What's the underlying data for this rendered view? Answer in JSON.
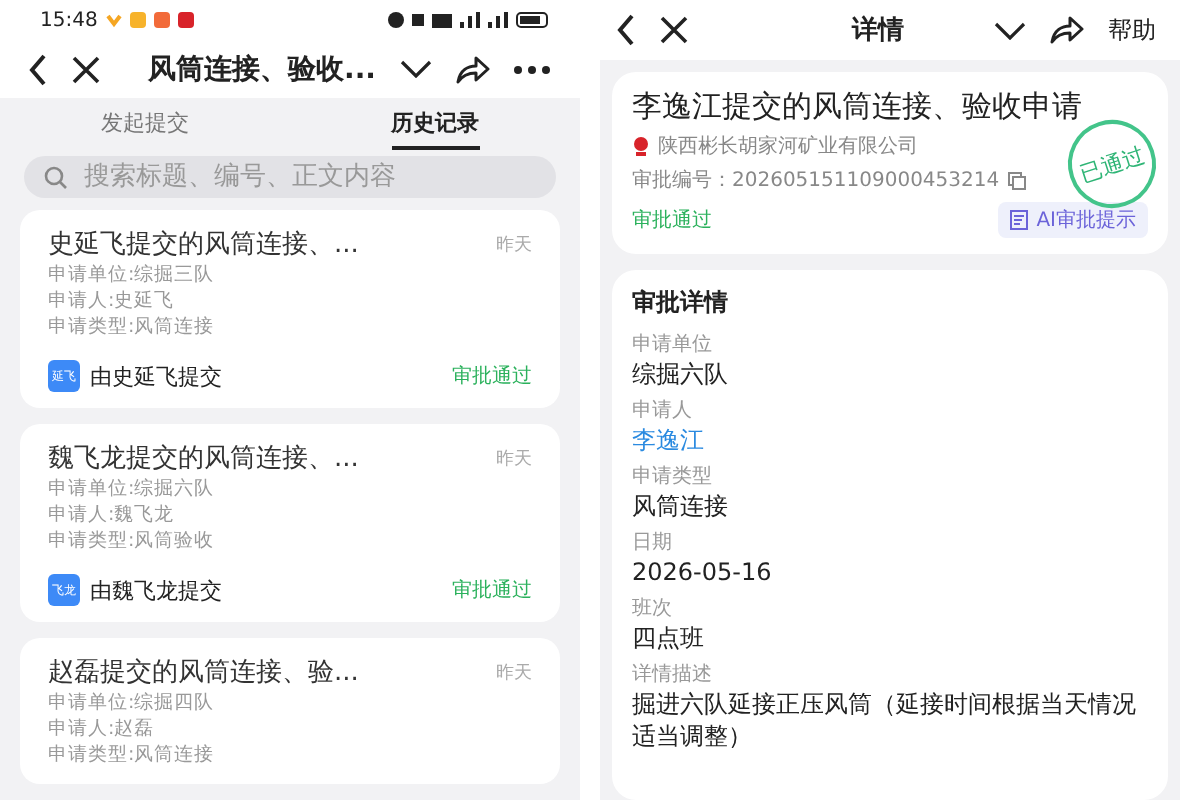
{
  "status_bar": {
    "time": "15:48"
  },
  "left": {
    "nav": {
      "title": "风筒连接、验收..."
    },
    "tabs": [
      {
        "label": "发起提交",
        "selected": false
      },
      {
        "label": "历史记录",
        "selected": true
      }
    ],
    "search": {
      "placeholder": "搜索标题、编号、正文内容"
    },
    "records": [
      {
        "title": "史延飞提交的风筒连接、...",
        "date": "昨天",
        "lines": [
          "申请单位:综掘三队",
          "申请人:史延飞",
          "申请类型:风筒连接"
        ],
        "avatar_text": "延飞",
        "submitter": "由史延飞提交",
        "status": "审批通过"
      },
      {
        "title": "魏飞龙提交的风筒连接、...",
        "date": "昨天",
        "lines": [
          "申请单位:综掘六队",
          "申请人:魏飞龙",
          "申请类型:风筒验收"
        ],
        "avatar_text": "飞龙",
        "submitter": "由魏飞龙提交",
        "status": "审批通过"
      },
      {
        "title": "赵磊提交的风筒连接、验...",
        "date": "昨天",
        "lines": [
          "申请单位:综掘四队",
          "申请人:赵磊",
          "申请类型:风筒连接"
        ]
      }
    ]
  },
  "right": {
    "nav": {
      "title": "详情",
      "help": "帮助"
    },
    "summary": {
      "title": "李逸江提交的风筒连接、验收申请",
      "company": "陕西彬长胡家河矿业有限公司",
      "number": "审批编号：202605151109000453214",
      "status": "审批通过",
      "ai_button": "AI审批提示",
      "stamp": "已通过"
    },
    "details": {
      "heading": "审批详情",
      "fields": [
        {
          "label": "申请单位",
          "value": "综掘六队",
          "link": false
        },
        {
          "label": "申请人",
          "value": "李逸江",
          "link": true
        },
        {
          "label": "申请类型",
          "value": "风筒连接",
          "link": false
        },
        {
          "label": "日期",
          "value": "2026-05-16",
          "link": false
        },
        {
          "label": "班次",
          "value": "四点班",
          "link": false
        },
        {
          "label": "详情描述",
          "value": "掘进六队延接正压风筒（延接时间根据当天情况适当调整）",
          "link": false
        }
      ]
    }
  }
}
